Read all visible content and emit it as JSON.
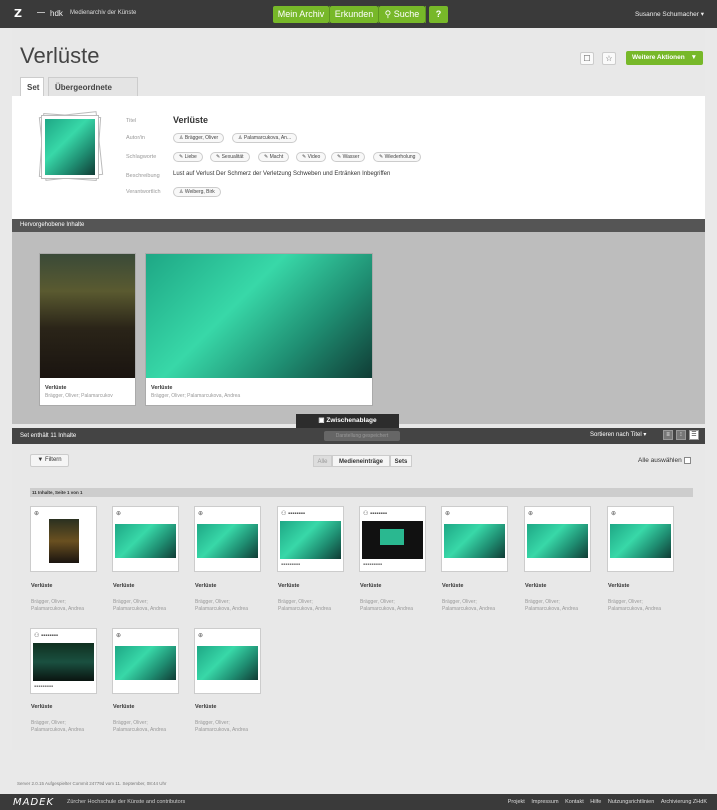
{
  "topbar": {
    "logo": "Z",
    "hdk": "hdk",
    "subtitle": "Medienarchiv der Künste",
    "nav": [
      "Mein Archiv",
      "Erkunden",
      "Suche",
      "?"
    ],
    "user": "Susanne Schumacher"
  },
  "page": {
    "title": "Verlüste",
    "more_actions": "Weitere Aktionen",
    "tabs": [
      "Set",
      "Übergeordnete Sets"
    ]
  },
  "meta": {
    "labels": {
      "title": "Titel",
      "author": "Autor/in",
      "keywords": "Schlagworte",
      "description": "Beschreibung",
      "responsible": "Verantwortlich"
    },
    "title_value": "Verlüste",
    "authors": [
      "Brägger, Oliver",
      "Palamarcukova, An..."
    ],
    "keywords": [
      "Liebe",
      "Sexualität",
      "Macht",
      "Video",
      "Wasser",
      "Wiederholung"
    ],
    "description": "Lust auf Verlust Der Schmerz der Verletzung Schweben und Ertränken Inbegriffen",
    "responsible": "Weiberg, Birk"
  },
  "highlights": {
    "header": "Hervorgehobene Inhalte",
    "items": [
      {
        "title": "Verlüste",
        "author": "Brägger, Oliver; Palamarcukov"
      },
      {
        "title": "Verlüste",
        "author": "Brägger, Oliver; Palamarcukova, Andrea"
      }
    ],
    "clipboard": "Zwischenablage"
  },
  "setbar": {
    "count": "Set enthält 11 Inhalte",
    "pill": "Darstellung gespeichert",
    "sort": "Sortieren nach Titel"
  },
  "toolbar": {
    "filter": "Filtern",
    "segments": [
      "Alle",
      "Medieneinträge",
      "Sets"
    ],
    "select_all": "Alle auswählen"
  },
  "grid": {
    "page_info": "11 Inhalte, Seite 1 von 1",
    "items": [
      {
        "title": "Verlüste",
        "author1": "Brägger, Oliver;",
        "author2": "Palamarcukova, Andrea"
      },
      {
        "title": "Verlüste",
        "author1": "Brägger, Oliver;",
        "author2": "Palamarcukova, Andrea"
      },
      {
        "title": "Verlüste",
        "author1": "Brägger, Oliver;",
        "author2": "Palamarcukova, Andrea"
      },
      {
        "title": "Verlüste",
        "author1": "Brägger, Oliver;",
        "author2": "Palamarcukova, Andrea"
      },
      {
        "title": "Verlüste",
        "author1": "Brägger, Oliver;",
        "author2": "Palamarcukova, Andrea"
      },
      {
        "title": "Verlüste",
        "author1": "Brägger, Oliver;",
        "author2": "Palamarcukova, Andrea"
      },
      {
        "title": "Verlüste",
        "author1": "Brägger, Oliver;",
        "author2": "Palamarcukova, Andrea"
      },
      {
        "title": "Verlüste",
        "author1": "Brägger, Oliver;",
        "author2": "Palamarcukova, Andrea"
      },
      {
        "title": "Verlüste",
        "author1": "Brägger, Oliver;",
        "author2": "Palamarcukova, Andrea"
      },
      {
        "title": "Verlüste",
        "author1": "Brägger, Oliver;",
        "author2": "Palamarcukova, Andrea"
      },
      {
        "title": "Verlüste",
        "author1": "Brägger, Oliver;",
        "author2": "Palamarcukova, Andrea"
      }
    ]
  },
  "footer": {
    "server_info": "Server 2.0.15 Aufgespielter Commit 24779d vom 11. September, 08:44 Uhr",
    "brand": "MADEK",
    "org": "Zürcher Hochschule der Künste and contributors",
    "links": [
      "Projekt",
      "Impressum",
      "Kontakt",
      "Hilfe",
      "Nutzungsrichtlinien",
      "Archivierung ZHdK"
    ]
  },
  "colors": {
    "accent": "#77b829",
    "dark": "#3a3a3a"
  }
}
